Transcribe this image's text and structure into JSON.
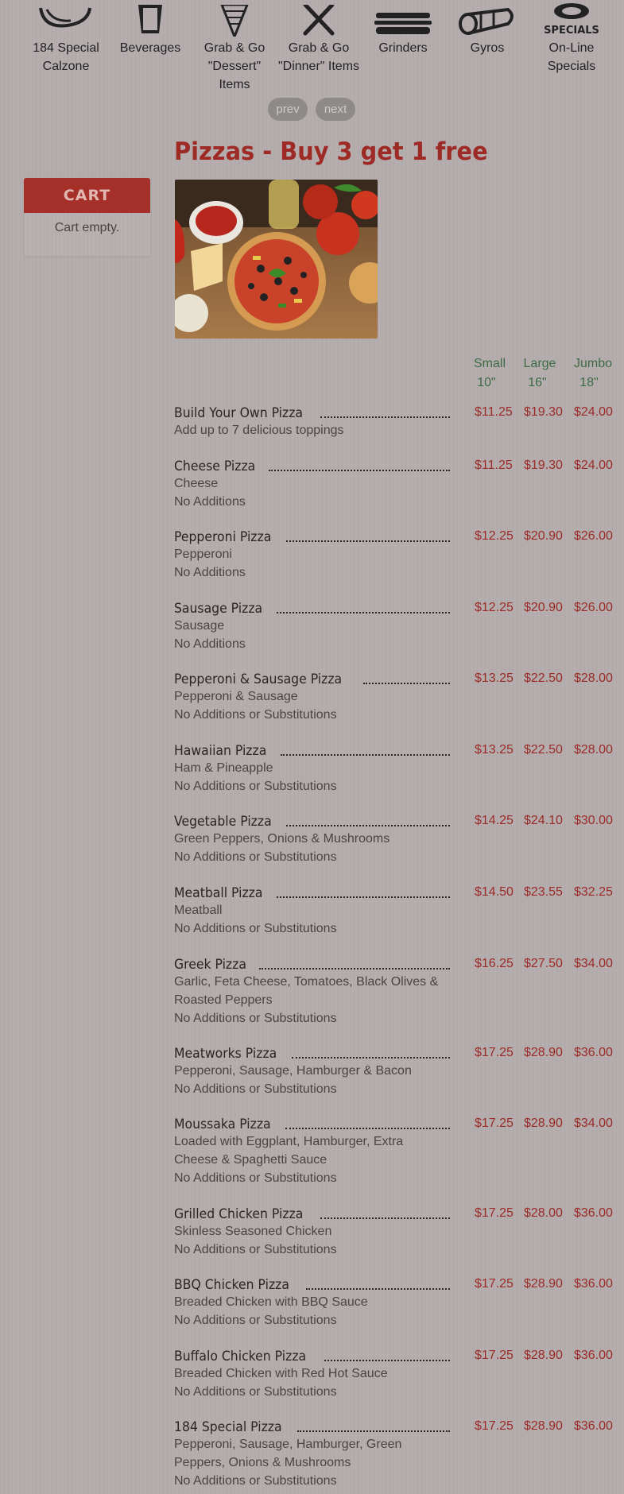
{
  "categories": [
    {
      "label": "184 Special Calzone",
      "icon": "calzone-icon"
    },
    {
      "label": "Beverages",
      "icon": "drink-cup-icon"
    },
    {
      "label": "Grab & Go \"Dessert\" Items",
      "icon": "ice-cream-cone-icon"
    },
    {
      "label": "Grab & Go \"Dinner\" Items",
      "icon": "fork-knife-icon"
    },
    {
      "label": "Grinders",
      "icon": "sandwich-icon"
    },
    {
      "label": "Gyros",
      "icon": "gyro-wrap-icon"
    },
    {
      "label": "On-Line Specials",
      "icon": "specials-icon",
      "icon_text": "SPECIALS"
    }
  ],
  "pager": {
    "prev": "prev",
    "next": "next"
  },
  "page_title": "Pizzas - Buy 3 get 1 free",
  "cart": {
    "title": "CART",
    "empty_text": "Cart empty."
  },
  "sizes": [
    {
      "name": "Small",
      "inches": "10\""
    },
    {
      "name": "Large",
      "inches": "16\""
    },
    {
      "name": "Jumbo",
      "inches": "18\""
    }
  ],
  "colors": {
    "accent": "#9e2a25",
    "size_header": "#3d6b45",
    "background": "#b5adad"
  },
  "items": [
    {
      "name": "Build Your Own Pizza",
      "desc": [
        "Add up to 7 delicious toppings"
      ],
      "prices": [
        "$11.25",
        "$19.30",
        "$24.00"
      ]
    },
    {
      "name": "Cheese Pizza",
      "desc": [
        "Cheese",
        "No Additions"
      ],
      "prices": [
        "$11.25",
        "$19.30",
        "$24.00"
      ]
    },
    {
      "name": "Pepperoni Pizza",
      "desc": [
        "Pepperoni",
        "No Additions"
      ],
      "prices": [
        "$12.25",
        "$20.90",
        "$26.00"
      ]
    },
    {
      "name": "Sausage Pizza",
      "desc": [
        "Sausage",
        "No Additions"
      ],
      "prices": [
        "$12.25",
        "$20.90",
        "$26.00"
      ]
    },
    {
      "name": "Pepperoni & Sausage Pizza",
      "desc": [
        "Pepperoni & Sausage",
        "No Additions or Substitutions"
      ],
      "prices": [
        "$13.25",
        "$22.50",
        "$28.00"
      ]
    },
    {
      "name": "Hawaiian Pizza",
      "desc": [
        "Ham & Pineapple",
        "No Additions or Substitutions"
      ],
      "prices": [
        "$13.25",
        "$22.50",
        "$28.00"
      ]
    },
    {
      "name": "Vegetable Pizza",
      "desc": [
        "Green Peppers, Onions & Mushrooms",
        "No Additions or Substitutions"
      ],
      "prices": [
        "$14.25",
        "$24.10",
        "$30.00"
      ]
    },
    {
      "name": "Meatball Pizza",
      "desc": [
        "Meatball",
        "No Additions or Substitutions"
      ],
      "prices": [
        "$14.50",
        "$23.55",
        "$32.25"
      ]
    },
    {
      "name": "Greek Pizza",
      "desc": [
        "Garlic, Feta Cheese, Tomatoes, Black Olives &",
        "Roasted Peppers",
        "No Additions or Substitutions"
      ],
      "prices": [
        "$16.25",
        "$27.50",
        "$34.00"
      ]
    },
    {
      "name": "Meatworks Pizza",
      "desc": [
        "Pepperoni, Sausage, Hamburger & Bacon",
        "No Additions or Substitutions"
      ],
      "prices": [
        "$17.25",
        "$28.90",
        "$36.00"
      ]
    },
    {
      "name": "Moussaka Pizza",
      "desc": [
        "Loaded with Eggplant, Hamburger, Extra",
        "Cheese & Spaghetti Sauce",
        "No Additions or Substitutions"
      ],
      "prices": [
        "$17.25",
        "$28.90",
        "$34.00"
      ]
    },
    {
      "name": "Grilled Chicken Pizza",
      "desc": [
        "Skinless Seasoned Chicken",
        "No Additions or Substitutions"
      ],
      "prices": [
        "$17.25",
        "$28.00",
        "$36.00"
      ]
    },
    {
      "name": "BBQ Chicken Pizza",
      "desc": [
        "Breaded Chicken with BBQ Sauce",
        "No Additions or Substitutions"
      ],
      "prices": [
        "$17.25",
        "$28.90",
        "$36.00"
      ]
    },
    {
      "name": "Buffalo Chicken Pizza",
      "desc": [
        "Breaded Chicken with Red Hot Sauce",
        "No Additions or Substitutions"
      ],
      "prices": [
        "$17.25",
        "$28.90",
        "$36.00"
      ]
    },
    {
      "name": "184 Special Pizza",
      "desc": [
        "Pepperoni, Sausage, Hamburger, Green",
        "Peppers, Onions & Mushrooms",
        "No Additions or Substitutions"
      ],
      "prices": [
        "$17.25",
        "$28.90",
        "$36.00"
      ]
    }
  ]
}
